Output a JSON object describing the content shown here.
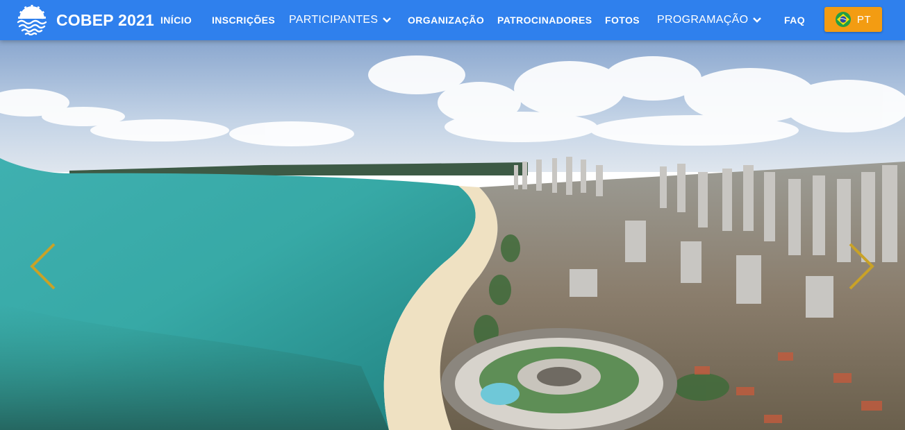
{
  "brand": {
    "name": "COBEP 2021",
    "logo_icon": "sun-waves-logo-icon"
  },
  "nav": {
    "inicio": "INÍCIO",
    "inscricoes": "INSCRIÇÕES",
    "participantes": "PARTICIPANTES",
    "organizacao": "ORGANIZAÇÃO",
    "patrocinadores": "PATROCINADORES",
    "fotos": "FOTOS",
    "programacao": "PROGRAMAÇÃO",
    "faq": "FAQ"
  },
  "language": {
    "label": "PT",
    "flag_icon": "brazil-flag-icon"
  },
  "hero": {
    "prev_icon": "chevron-left-icon",
    "next_icon": "chevron-right-icon"
  },
  "colors": {
    "navbar": "#2f80ed",
    "language_button": "#f39c12",
    "arrow": "#c9a227"
  }
}
